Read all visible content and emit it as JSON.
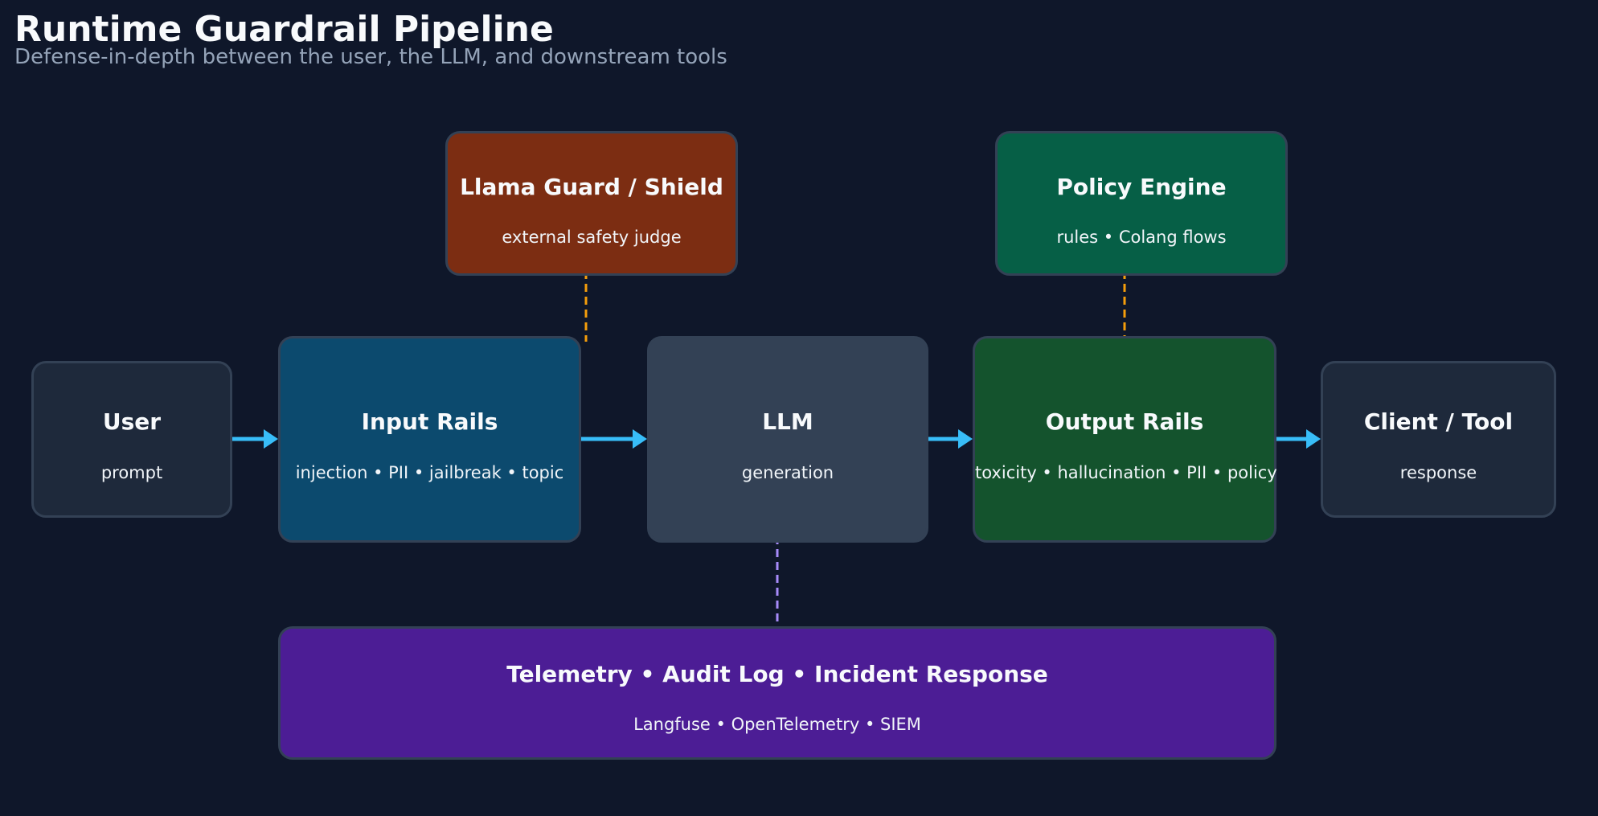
{
  "header": {
    "title": "Runtime Guardrail Pipeline",
    "subtitle": "Defense-in-depth between the user, the LLM, and downstream tools"
  },
  "nodes": {
    "user": {
      "title": "User",
      "subtitle": "prompt"
    },
    "input_rails": {
      "title": "Input Rails",
      "subtitle": "injection • PII • jailbreak • topic"
    },
    "llm": {
      "title": "LLM",
      "subtitle": "generation"
    },
    "output_rails": {
      "title": "Output Rails",
      "subtitle": "toxicity • hallucination • PII • policy"
    },
    "client_tool": {
      "title": "Client / Tool",
      "subtitle": "response"
    },
    "llama_guard": {
      "title": "Llama Guard / Shield",
      "subtitle": "external safety judge"
    },
    "policy_engine": {
      "title": "Policy Engine",
      "subtitle": "rules • Colang flows"
    },
    "telemetry": {
      "title": "Telemetry • Audit Log • Incident Response",
      "subtitle": "Langfuse • OpenTelemetry • SIEM"
    }
  },
  "colors": {
    "background": "#0f172a",
    "flow_arrow": "#38bdf8",
    "judge_link": "#f59e0b",
    "telemetry_link": "#a78bfa",
    "input_rails": "#0c4a6e",
    "output_rails": "#14532d",
    "llama_guard": "#7c2d12",
    "policy_engine": "#065f46",
    "telemetry": "#4c1d95"
  }
}
